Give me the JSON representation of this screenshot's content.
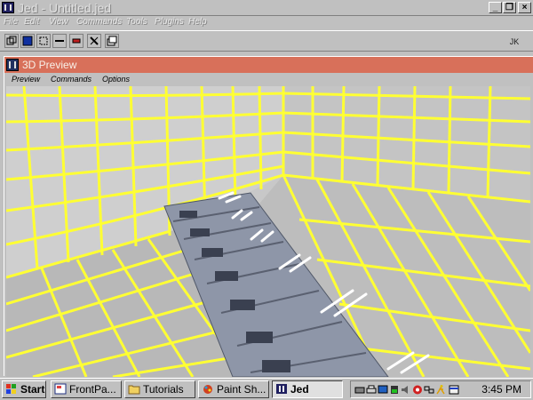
{
  "app": {
    "title": "Jed - Untitled.jed",
    "menu": [
      "File",
      "Edit",
      "View",
      "Commands",
      "Tools",
      "Plugins",
      "Help"
    ],
    "toolbar_label": "JK",
    "window_buttons": [
      "_",
      "❐",
      "×"
    ]
  },
  "preview": {
    "title": "3D Preview",
    "menu": [
      "Preview",
      "Commands",
      "Options"
    ]
  },
  "taskbar": {
    "start_label": "Start",
    "tasks": [
      "FrontPa...",
      "Tutorials",
      "Paint Sh...",
      "Jed"
    ],
    "clock": "3:45 PM"
  },
  "colors": {
    "grid_line": "#ffff33",
    "floor": "#8e96a8",
    "preview_title_bar": "#d8705a",
    "desktop": "#c0c0c0"
  }
}
